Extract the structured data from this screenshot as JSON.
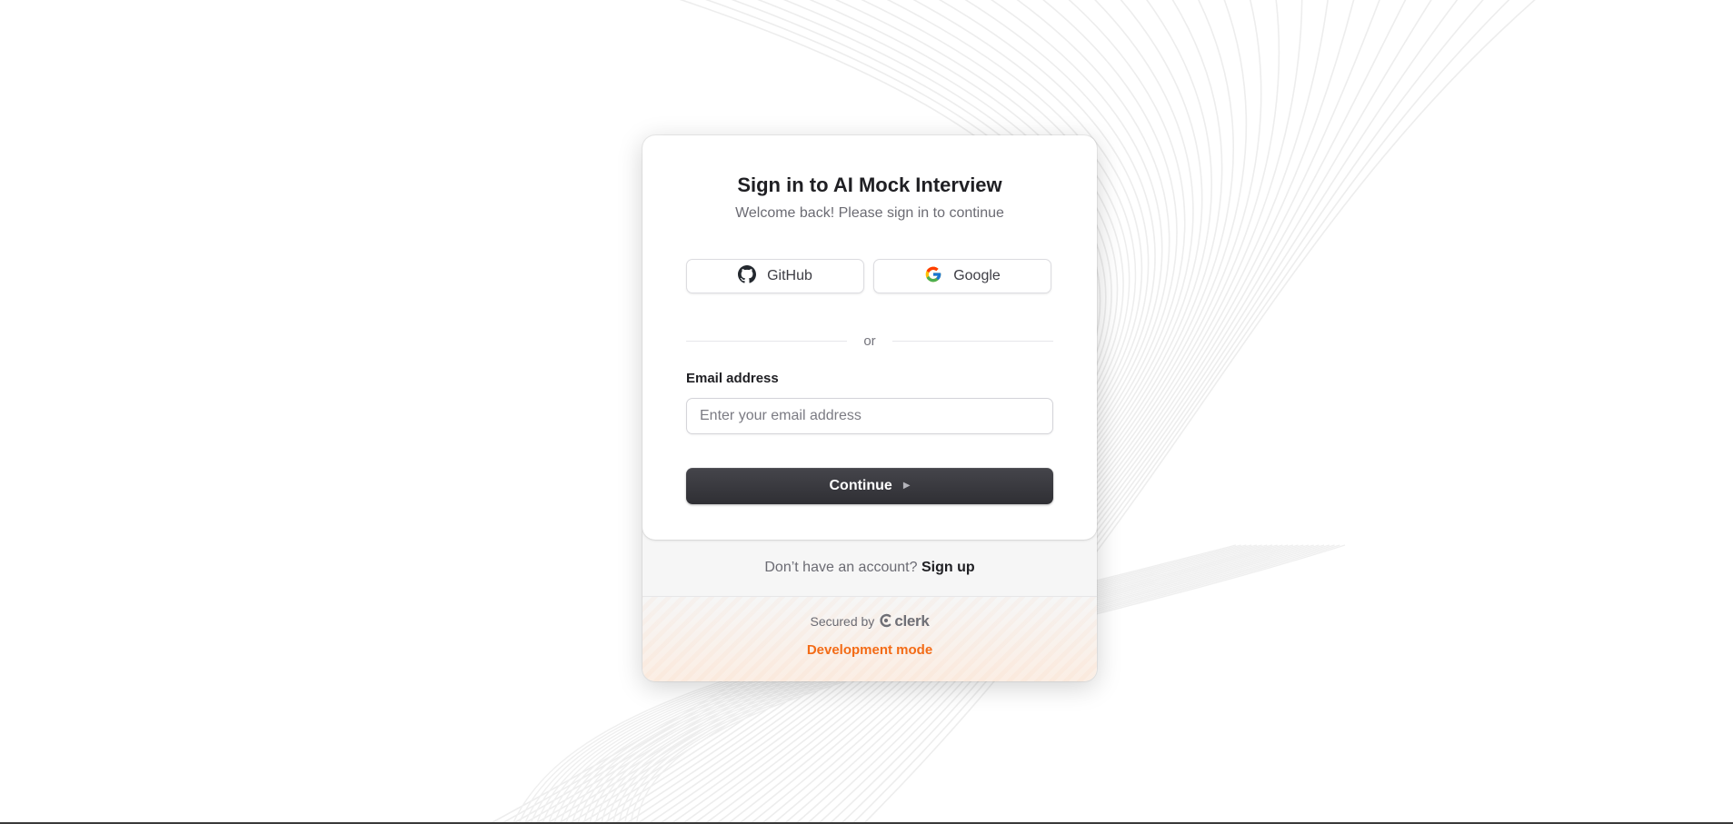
{
  "card": {
    "title": "Sign in to AI Mock Interview",
    "subtitle": "Welcome back! Please sign in to continue"
  },
  "social": {
    "github_label": "GitHub",
    "github_icon": "github-icon",
    "google_label": "Google",
    "google_icon": "google-icon"
  },
  "divider": {
    "text": "or"
  },
  "email": {
    "label": "Email address",
    "placeholder": "Enter your email address",
    "value": ""
  },
  "continue": {
    "label": "Continue",
    "icon": "triangle-right-icon"
  },
  "signup": {
    "prompt": "Don’t have an account?",
    "link": "Sign up"
  },
  "footer": {
    "secured_by": "Secured by",
    "brand": "clerk",
    "brand_icon": "clerk-logo-icon",
    "dev_mode": "Development mode"
  },
  "colors": {
    "accent_orange": "#f36b16",
    "primary_button": "#2f2f34",
    "text_dark": "#1f1f23",
    "text_muted": "#6b6b73"
  }
}
